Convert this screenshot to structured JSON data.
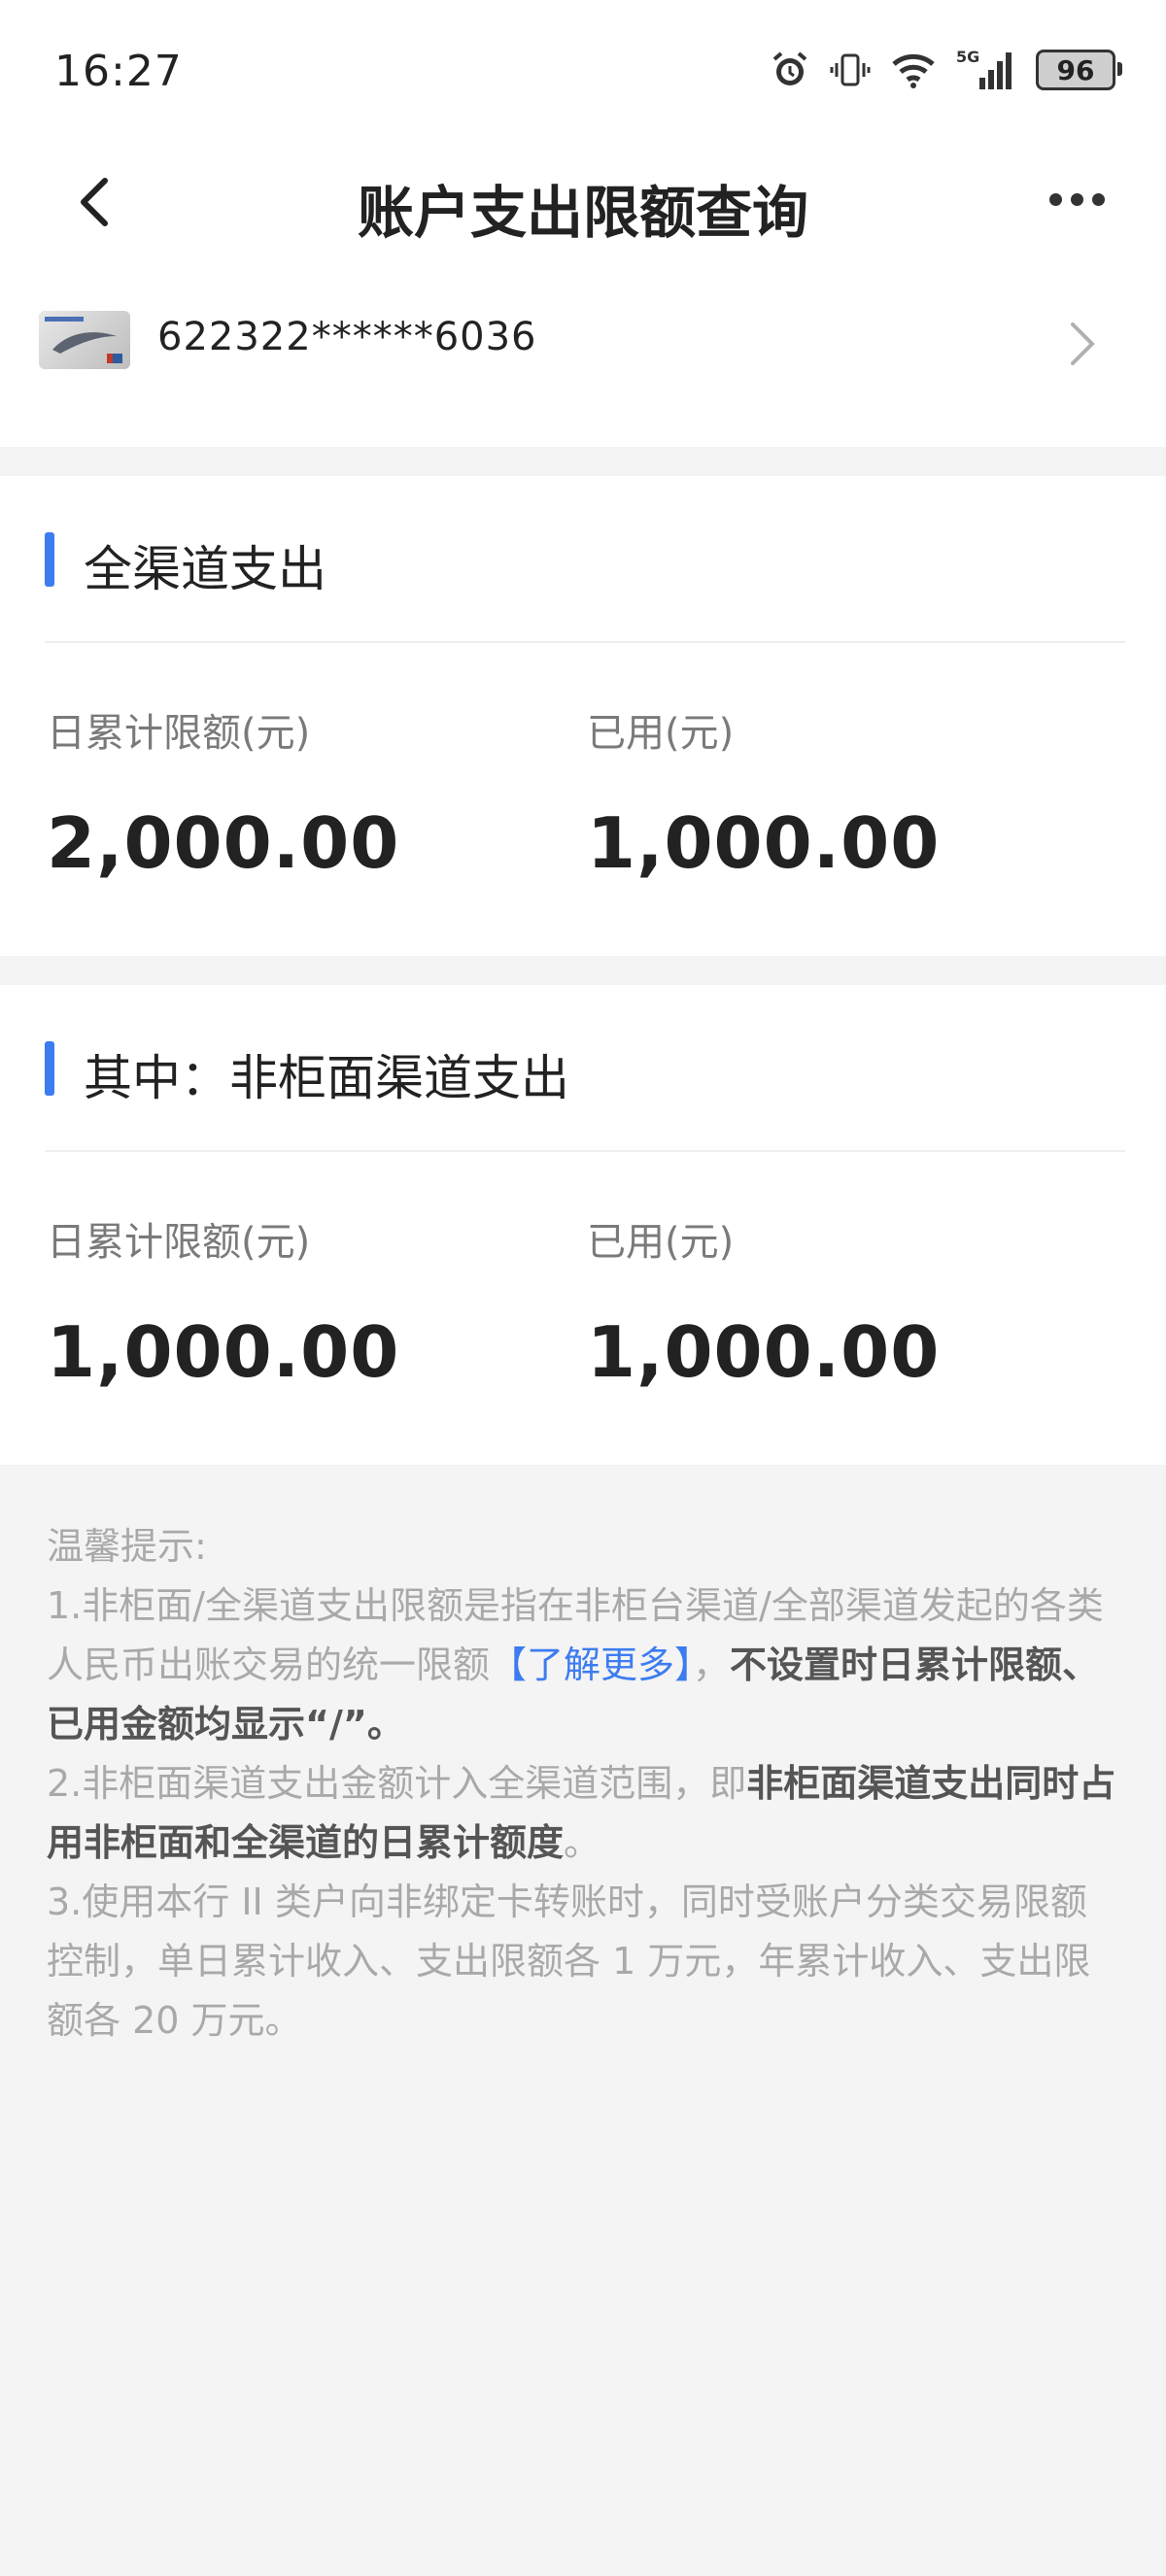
{
  "status_bar": {
    "time": "16:27",
    "network": "5G",
    "battery": "96"
  },
  "header": {
    "title": "账户支出限额查询",
    "back_icon": "chevron-left-icon",
    "more_icon": "more-horizontal-icon"
  },
  "account": {
    "card_number": "622322******6036"
  },
  "sections": [
    {
      "title": "全渠道支出",
      "daily_limit_label": "日累计限额(元)",
      "daily_limit_value": "2,000.00",
      "used_label": "已用(元)",
      "used_value": "1,000.00"
    },
    {
      "title": "其中：非柜面渠道支出",
      "daily_limit_label": "日累计限额(元)",
      "daily_limit_value": "1,000.00",
      "used_label": "已用(元)",
      "used_value": "1,000.00"
    }
  ],
  "tips": {
    "heading": "温馨提示:",
    "item1_text": "1.非柜面/全渠道支出限额是指在非柜台渠道/全部渠道发起的各类人民币出账交易的统一限额",
    "item1_link": "【了解更多】",
    "item1_sep": "，",
    "item1_bold": "不设置时日累计限额、已用金额均显示“/”。",
    "item2_text": "2.非柜面渠道支出金额计入全渠道范围，即",
    "item2_bold": "非柜面渠道支出同时占用非柜面和全渠道的日累计额度",
    "item2_end": "。",
    "item3_text": "3.使用本行 II 类户向非绑定卡转账时，同时受账户分类交易限额控制，单日累计收入、支出限额各 1 万元，年累计收入、支出限额各 20 万元。"
  },
  "colors": {
    "accent": "#3d7cf0",
    "text": "#222222",
    "muted": "#a9a9a9",
    "background": "#f4f4f4"
  }
}
